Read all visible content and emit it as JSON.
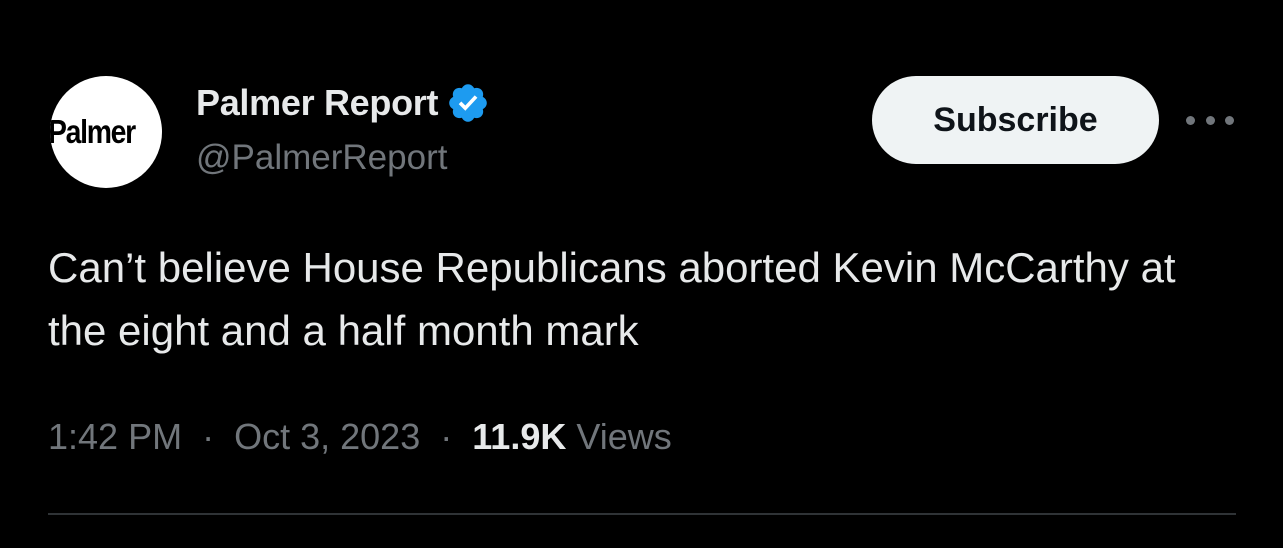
{
  "account": {
    "display_name": "Palmer Report",
    "handle": "@PalmerReport",
    "avatar_text": "Palmer",
    "verified": true,
    "verified_color": "#1d9bf0"
  },
  "actions": {
    "subscribe_label": "Subscribe",
    "more_icon": "more-horizontal-icon"
  },
  "tweet": {
    "text": "Can’t believe House Republicans aborted Kevin McCarthy at the eight and a half month mark"
  },
  "meta": {
    "time": "1:42 PM",
    "separator": "·",
    "date": "Oct 3, 2023",
    "views_count": "11.9K",
    "views_label": "Views"
  },
  "colors": {
    "background": "#000000",
    "primary_text": "#e7e9ea",
    "secondary_text": "#71767b",
    "button_bg": "#eff3f4",
    "divider": "#2f3336"
  }
}
